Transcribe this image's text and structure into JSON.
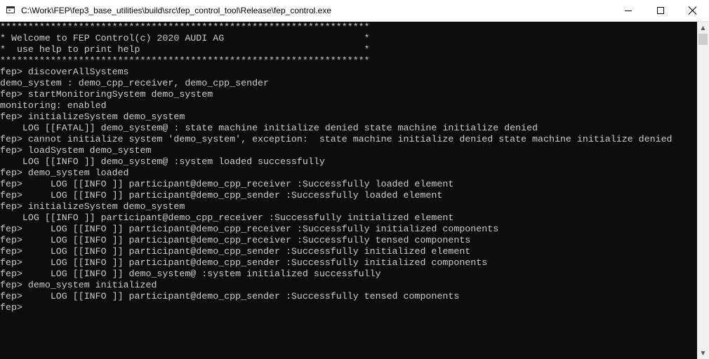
{
  "window": {
    "title": "C:\\Work\\FEP\\fep3_base_utilities\\build\\src\\fep_control_tool\\Release\\fep_control.exe",
    "icon": "console-app-icon",
    "controls": {
      "minimize": "minimize-icon",
      "maximize": "maximize-icon",
      "close": "close-icon"
    }
  },
  "colors": {
    "console_background": "#0c0c0c",
    "console_text": "#cccccc",
    "titlebar_background": "#ffffff"
  },
  "scrollbar": {
    "up_icon": "▲",
    "down_icon": "▼"
  },
  "console": {
    "lines": [
      "******************************************************************",
      "* Welcome to FEP Control(c) 2020 AUDI AG                         *",
      "*  use help to print help                                        *",
      "******************************************************************",
      "fep> discoverAllSystems",
      "demo_system : demo_cpp_receiver, demo_cpp_sender",
      "fep> startMonitoringSystem demo_system",
      "monitoring: enabled",
      "fep> initializeSystem demo_system",
      "    LOG [[FATAL]] demo_system@ : state machine initialize denied state machine initialize denied",
      "fep> cannot initialize system 'demo_system', exception:  state machine initialize denied state machine initialize denied",
      "fep> loadSystem demo_system",
      "    LOG [[INFO ]] demo_system@ :system loaded successfully",
      "fep> demo_system loaded",
      "fep>     LOG [[INFO ]] participant@demo_cpp_receiver :Successfully loaded element",
      "fep>     LOG [[INFO ]] participant@demo_cpp_sender :Successfully loaded element",
      "fep> initializeSystem demo_system",
      "    LOG [[INFO ]] participant@demo_cpp_receiver :Successfully initialized element",
      "fep>     LOG [[INFO ]] participant@demo_cpp_receiver :Successfully initialized components",
      "fep>     LOG [[INFO ]] participant@demo_cpp_receiver :Successfully tensed components",
      "fep>     LOG [[INFO ]] participant@demo_cpp_sender :Successfully initialized element",
      "fep>     LOG [[INFO ]] participant@demo_cpp_sender :Successfully initialized components",
      "fep>     LOG [[INFO ]] demo_system@ :system initialized successfully",
      "fep> demo_system initialized",
      "fep>     LOG [[INFO ]] participant@demo_cpp_sender :Successfully tensed components",
      "fep>"
    ]
  }
}
